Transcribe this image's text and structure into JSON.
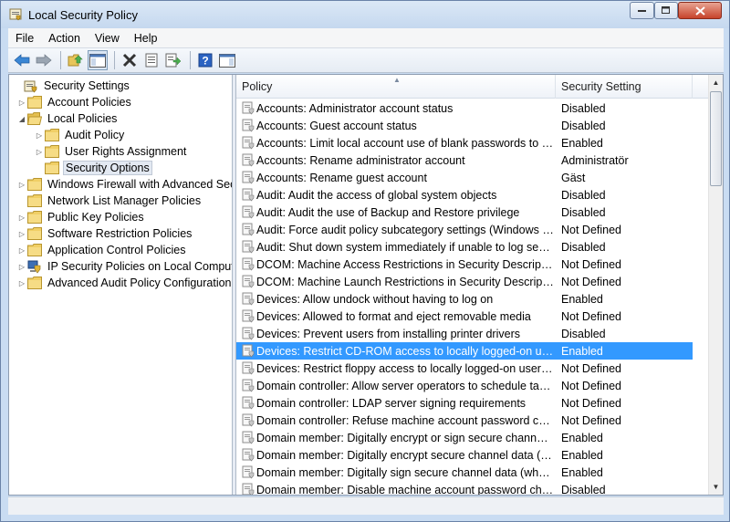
{
  "window": {
    "title": "Local Security Policy"
  },
  "menu": [
    "File",
    "Action",
    "View",
    "Help"
  ],
  "tree": [
    {
      "label": "Security Settings",
      "level": 0,
      "arrow": "",
      "icon": "security-settings-icon",
      "selected": false
    },
    {
      "label": "Account Policies",
      "level": 1,
      "arrow": "collapsed",
      "icon": "folder-icon",
      "selected": false
    },
    {
      "label": "Local Policies",
      "level": 1,
      "arrow": "expanded",
      "icon": "folder-open-icon",
      "selected": false
    },
    {
      "label": "Audit Policy",
      "level": 2,
      "arrow": "collapsed",
      "icon": "folder-icon",
      "selected": false
    },
    {
      "label": "User Rights Assignment",
      "level": 2,
      "arrow": "collapsed",
      "icon": "folder-icon",
      "selected": false
    },
    {
      "label": "Security Options",
      "level": 2,
      "arrow": "",
      "icon": "folder-icon",
      "selected": true
    },
    {
      "label": "Windows Firewall with Advanced Security",
      "level": 1,
      "arrow": "collapsed",
      "icon": "folder-icon",
      "selected": false
    },
    {
      "label": "Network List Manager Policies",
      "level": 1,
      "arrow": "",
      "icon": "folder-icon",
      "selected": false
    },
    {
      "label": "Public Key Policies",
      "level": 1,
      "arrow": "collapsed",
      "icon": "folder-icon",
      "selected": false
    },
    {
      "label": "Software Restriction Policies",
      "level": 1,
      "arrow": "collapsed",
      "icon": "folder-icon",
      "selected": false
    },
    {
      "label": "Application Control Policies",
      "level": 1,
      "arrow": "collapsed",
      "icon": "folder-icon",
      "selected": false
    },
    {
      "label": "IP Security Policies on Local Computer",
      "level": 1,
      "arrow": "collapsed",
      "icon": "ip-security-icon",
      "selected": false
    },
    {
      "label": "Advanced Audit Policy Configuration",
      "level": 1,
      "arrow": "collapsed",
      "icon": "folder-icon",
      "selected": false
    }
  ],
  "list": {
    "columns": {
      "policy": "Policy",
      "setting": "Security Setting"
    },
    "rows": [
      {
        "policy": "Accounts: Administrator account status",
        "setting": "Disabled"
      },
      {
        "policy": "Accounts: Guest account status",
        "setting": "Disabled"
      },
      {
        "policy": "Accounts: Limit local account use of blank passwords to co...",
        "setting": "Enabled"
      },
      {
        "policy": "Accounts: Rename administrator account",
        "setting": "Administratör"
      },
      {
        "policy": "Accounts: Rename guest account",
        "setting": "Gäst"
      },
      {
        "policy": "Audit: Audit the access of global system objects",
        "setting": "Disabled"
      },
      {
        "policy": "Audit: Audit the use of Backup and Restore privilege",
        "setting": "Disabled"
      },
      {
        "policy": "Audit: Force audit policy subcategory settings (Windows Vis...",
        "setting": "Not Defined"
      },
      {
        "policy": "Audit: Shut down system immediately if unable to log secur...",
        "setting": "Disabled"
      },
      {
        "policy": "DCOM: Machine Access Restrictions in Security Descriptor D...",
        "setting": "Not Defined"
      },
      {
        "policy": "DCOM: Machine Launch Restrictions in Security Descriptor ...",
        "setting": "Not Defined"
      },
      {
        "policy": "Devices: Allow undock without having to log on",
        "setting": "Enabled"
      },
      {
        "policy": "Devices: Allowed to format and eject removable media",
        "setting": "Not Defined"
      },
      {
        "policy": "Devices: Prevent users from installing printer drivers",
        "setting": "Disabled"
      },
      {
        "policy": "Devices: Restrict CD-ROM access to locally logged-on user ...",
        "setting": "Enabled",
        "selected": true
      },
      {
        "policy": "Devices: Restrict floppy access to locally logged-on user only",
        "setting": "Not Defined"
      },
      {
        "policy": "Domain controller: Allow server operators to schedule tasks",
        "setting": "Not Defined"
      },
      {
        "policy": "Domain controller: LDAP server signing requirements",
        "setting": "Not Defined"
      },
      {
        "policy": "Domain controller: Refuse machine account password chan...",
        "setting": "Not Defined"
      },
      {
        "policy": "Domain member: Digitally encrypt or sign secure channel d...",
        "setting": "Enabled"
      },
      {
        "policy": "Domain member: Digitally encrypt secure channel data (wh...",
        "setting": "Enabled"
      },
      {
        "policy": "Domain member: Digitally sign secure channel data (when ...",
        "setting": "Enabled"
      },
      {
        "policy": "Domain member: Disable machine account password chan...",
        "setting": "Disabled"
      }
    ]
  },
  "colors": {
    "selection": "#3399ff",
    "title_bg": "#c9dcf2"
  }
}
